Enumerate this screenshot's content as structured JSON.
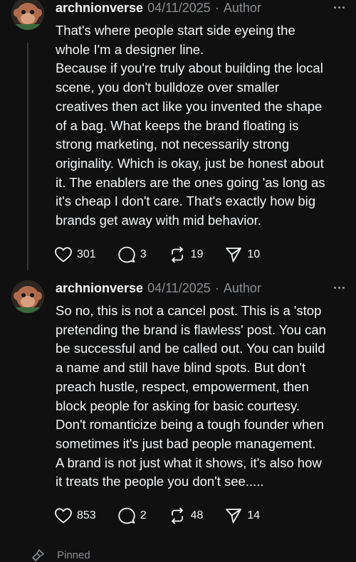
{
  "posts": [
    {
      "username": "archnionverse",
      "date": "04/11/2025",
      "separator": "·",
      "author_badge": "Author",
      "lines": [
        "That's where people start side eyeing the",
        "whole I'm a designer line.",
        "Because if you're truly about building the local",
        "scene, you don't bulldoze over smaller",
        "creatives then act like you invented the shape",
        "of a bag. What keeps the brand floating is",
        "strong marketing, not necessarily strong",
        "originality. Which is okay, just be honest about",
        "it. The enablers are the ones going 'as long as",
        "it's cheap I don't care. That's exactly how big",
        "brands get away with mid behavior."
      ],
      "likes": "301",
      "replies": "3",
      "reposts": "19",
      "shares": "10"
    },
    {
      "username": "archnionverse",
      "date": "04/11/2025",
      "separator": "·",
      "author_badge": "Author",
      "lines": [
        "So no, this is not a cancel post. This is a 'stop",
        "pretending the brand is flawless' post. You can",
        "be successful and be called out. You can build",
        "a name and still have blind spots. But don't",
        "preach hustle, respect, empowerment, then",
        "block people for asking for basic courtesy.",
        "Don't romanticize being a tough founder when",
        "sometimes it's just bad people management.",
        "A brand is not just what it shows, it's also how",
        "it treats the people you don't see....."
      ],
      "likes": "853",
      "replies": "2",
      "reposts": "48",
      "shares": "14"
    }
  ],
  "footer": {
    "text": "Pinned"
  },
  "icons": {
    "like": "heart-icon",
    "reply": "comment-icon",
    "repost": "repost-icon",
    "share": "share-icon",
    "more": "more-icon"
  }
}
